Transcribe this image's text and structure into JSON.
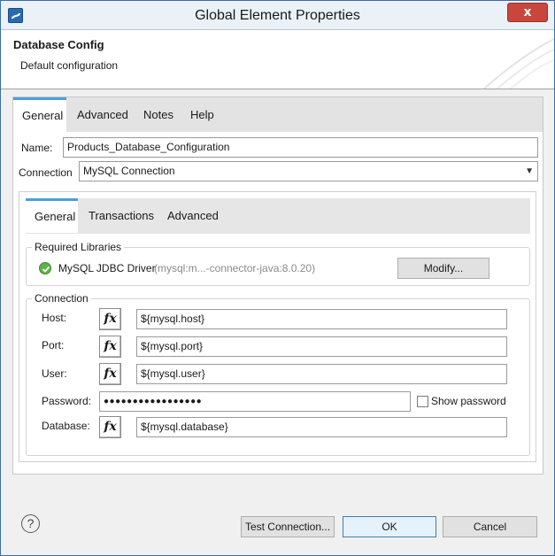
{
  "window": {
    "title": "Global Element Properties",
    "close_label": "x",
    "icons": {
      "app": "mule-app-icon",
      "close": "close-icon"
    }
  },
  "header": {
    "title": "Database Config",
    "subtitle": "Default configuration"
  },
  "outer_tabs": [
    {
      "label": "General",
      "active": true
    },
    {
      "label": "Advanced",
      "active": false
    },
    {
      "label": "Notes",
      "active": false
    },
    {
      "label": "Help",
      "active": false
    }
  ],
  "name_field": {
    "label": "Name:",
    "value": "Products_Database_Configuration"
  },
  "connection_select": {
    "label": "Connection",
    "value": "MySQL Connection"
  },
  "inner_tabs": [
    {
      "label": "General",
      "active": true
    },
    {
      "label": "Transactions",
      "active": false
    },
    {
      "label": "Advanced",
      "active": false
    }
  ],
  "required_libraries": {
    "title": "Required Libraries",
    "driver_name": "MySQL JDBC Driver",
    "driver_detail": "(mysql:m...-connector-java:8.0.20)",
    "modify_label": "Modify..."
  },
  "connection_group": {
    "title": "Connection",
    "fx_label": "fx",
    "host": {
      "label": "Host:",
      "value": "${mysql.host}"
    },
    "port": {
      "label": "Port:",
      "value": "${mysql.port}"
    },
    "user": {
      "label": "User:",
      "value": "${mysql.user}"
    },
    "password": {
      "label": "Password:",
      "value": "●●●●●●●●●●●●●●●●●",
      "show_label": "Show password",
      "show_checked": false
    },
    "database": {
      "label": "Database:",
      "value": "${mysql.database}"
    }
  },
  "footer": {
    "help_label": "?",
    "test_connection_label": "Test Connection...",
    "ok_label": "OK",
    "cancel_label": "Cancel"
  },
  "colors": {
    "tab_accent": "#4ba0d8",
    "close_button": "#c9463d",
    "success": "#5fb14b"
  }
}
